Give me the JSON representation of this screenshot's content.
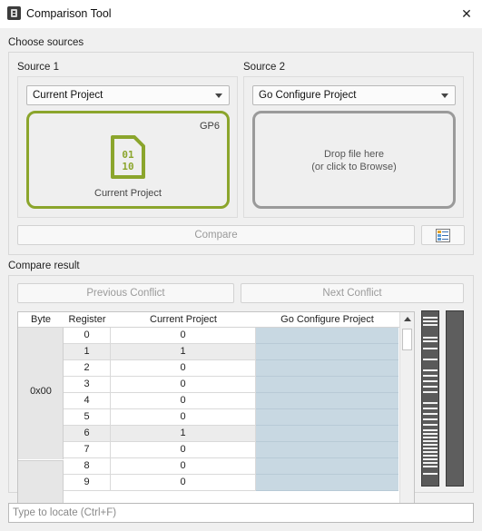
{
  "window": {
    "title": "Comparison Tool",
    "app_icon": "app-icon",
    "close_icon": "close-icon",
    "close_glyph": "✕"
  },
  "sources": {
    "section_title": "Choose sources",
    "source1": {
      "label": "Source 1",
      "combo_value": "Current Project",
      "chip_label": "GP6",
      "file_caption": "Current Project",
      "file_icon": "binary-file-icon",
      "accent_color": "#8ba52c"
    },
    "source2": {
      "label": "Source 2",
      "combo_value": "Go Configure Project",
      "drop_line1": "Drop file here",
      "drop_line2": "(or click to Browse)"
    },
    "compare_label": "Compare",
    "settings_icon": "list-settings-icon"
  },
  "result": {
    "section_title": "Compare result",
    "prev_label": "Previous Conflict",
    "next_label": "Next Conflict",
    "columns": [
      "Byte",
      "Register",
      "Current Project",
      "Go Configure Project"
    ],
    "byte_group": "0x00",
    "rows": [
      {
        "register": "0",
        "current": "0",
        "go": ""
      },
      {
        "register": "1",
        "current": "1",
        "go": ""
      },
      {
        "register": "2",
        "current": "0",
        "go": ""
      },
      {
        "register": "3",
        "current": "0",
        "go": ""
      },
      {
        "register": "4",
        "current": "0",
        "go": ""
      },
      {
        "register": "5",
        "current": "0",
        "go": ""
      },
      {
        "register": "6",
        "current": "1",
        "go": ""
      },
      {
        "register": "7",
        "current": "0",
        "go": ""
      },
      {
        "register": "8",
        "current": "0",
        "go": ""
      },
      {
        "register": "9",
        "current": "0",
        "go": ""
      }
    ],
    "highlight_color": "#c8d8e2"
  },
  "locate": {
    "placeholder": "Type to locate (Ctrl+F)",
    "value": ""
  }
}
